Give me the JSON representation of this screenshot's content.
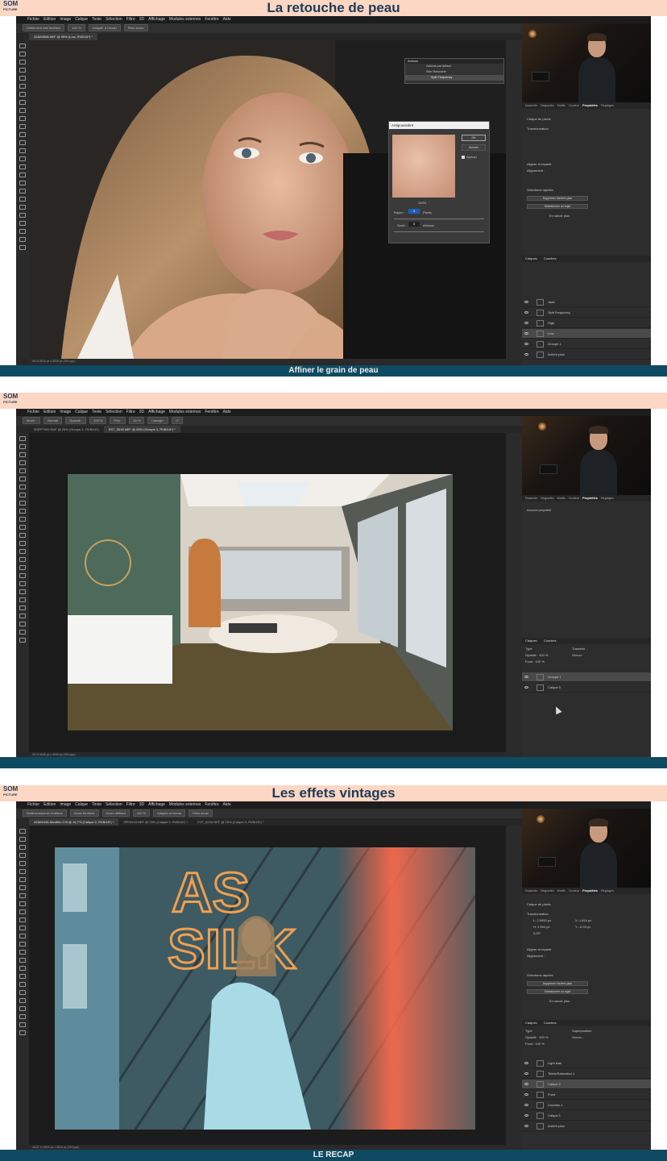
{
  "panels": [
    {
      "title": "La retouche de peau",
      "caption": "Affiner le grain de peau",
      "menu": [
        "Fichier",
        "Edition",
        "Image",
        "Calque",
        "Texte",
        "Sélection",
        "Filtre",
        "3D",
        "Affichage",
        "Modules externes",
        "Fenêtre",
        "Aide"
      ],
      "options": [
        "Défilement des fenêtres",
        "100 %",
        "Adapter à l'écran",
        "Plein écran"
      ],
      "tabs": [
        "3Z8A9608.NEF @ 95% (Low, RVB/16*) *"
      ],
      "status": "95 %   6016 px x 4016 px (300 ppp)",
      "prop_tabs": [
        "Nuancier",
        "Dégradés",
        "Motifs",
        "Couleur",
        "Propriétés",
        "Réglages"
      ],
      "prop_active": "Propriétés",
      "prop_lines": [
        "Calque de pixels",
        "Transformation",
        "Aligner et répartir",
        "Alignement :",
        "Sélections rapides",
        "Supprimer l'arrière-plan",
        "Sélectionner un sujet",
        "En savoir plus"
      ],
      "layers_tabs": [
        "Calques",
        "Couches"
      ],
      "layers": [
        "Jade",
        "Split Frequency",
        "High",
        "Low",
        "Groupe 1",
        "Arrière-plan"
      ],
      "actions": {
        "title": "Actions",
        "items": [
          "Actions par défaut",
          "Skin Retouche",
          "Split Frequency"
        ]
      },
      "dialog": {
        "title": "Antipoussière",
        "ok": "OK",
        "cancel": "Annuler",
        "preview": "Aperçu",
        "zoom": "100%",
        "rayon_label": "Rayon :",
        "rayon_value": "3",
        "rayon_unit": "Pixels",
        "seuil_label": "Seuil :",
        "seuil_value": "0",
        "seuil_unit": "niveaux"
      }
    },
    {
      "title": "",
      "caption": "",
      "menu": [
        "Fichier",
        "Edition",
        "Image",
        "Calque",
        "Texte",
        "Sélection",
        "Filtre",
        "3D",
        "Affichage",
        "Modules externes",
        "Fenêtre",
        "Aide"
      ],
      "options": [
        "Mode :",
        "Normal",
        "Opacité :",
        "100 %",
        "Flux :",
        "18 %",
        "Lissage :",
        "0°"
      ],
      "tabs": [
        "3SEPT991.RAF @ 25% (Groupe 1, RVB/16*)",
        "EST_0516.NEF @ 25% (Groupe 1, RVB/16*) *"
      ],
      "status": "25 %   6048 px x 4032 px (240 ppp)",
      "prop_tabs": [
        "Nuancier",
        "Dégradés",
        "Motifs",
        "Couleur",
        "Propriétés",
        "Réglages"
      ],
      "prop_active": "Propriétés",
      "prop_lines": [
        "Aucune propriété"
      ],
      "layers_tabs": [
        "Calques",
        "Couches"
      ],
      "layers_opts": [
        "Type",
        "Transmis",
        "Opacité : 100 %",
        "Verrou :",
        "Fond : 100 %"
      ],
      "layers": [
        "Groupe 1",
        "Calque 0"
      ]
    },
    {
      "title": "Les effets vintages",
      "caption": "LE RECAP",
      "menu": [
        "Fichier",
        "Edition",
        "Image",
        "Calque",
        "Texte",
        "Sélection",
        "Filtre",
        "3D",
        "Affichage",
        "Modules externes",
        "Fenêtre",
        "Aide"
      ],
      "options": [
        "Redimensionner fenêtres",
        "Zoom fenêtres",
        "Zoom défilant",
        "100 %",
        "Adapter à l'écran",
        "Plein écran"
      ],
      "tabs": [
        "3Z8A9446-Modifier-2.tif @ 16,7% (Calque 2, RVB/16*) *",
        "3PE5918.NEF @ 25% (Calque 0, RVB/16*) *",
        "EST_6235.NEF @ 25% (Calque 0, RVB/16*) *"
      ],
      "status": "16,67 %   6016 px x 4016 px (240 ppp)",
      "prop_tabs": [
        "Nuancier",
        "Dégradés",
        "Motifs",
        "Couleur",
        "Propriétés",
        "Réglages"
      ],
      "prop_active": "Propriétés",
      "prop_lines": [
        "Calque de pixels",
        "Transformation",
        "Aligner et répartir",
        "Alignement :",
        "Sélections rapides",
        "Supprimer l'arrière-plan",
        "Sélectionner un sujet",
        "En savoir plus"
      ],
      "transform": [
        "L: 2.0000 px",
        "H: 1.904 px",
        "X: 1.814 px",
        "Y: -0.03 px",
        "0,00°"
      ],
      "layers_tabs": [
        "Calques",
        "Couches"
      ],
      "layers_opts": [
        "Type",
        "Superposition",
        "Opacité : 100 %",
        "Verrou :",
        "Fond : 100 %"
      ],
      "layers": [
        "Light leak",
        "Teinte/Saturation 1",
        "Calque 2",
        "Fond",
        "Courbes 1",
        "Calque 1",
        "Arrière-plan"
      ]
    }
  ],
  "neon_text": [
    "AS",
    "SILK"
  ],
  "logo": {
    "top": "SOM",
    "bottom": "PICTURE"
  },
  "colors": {
    "header_bg": "#fbd7c4",
    "header_text": "#1f3b57",
    "footer_bg": "#0f4a63",
    "ps_dark": "#282828",
    "neon": "#f0a050"
  }
}
